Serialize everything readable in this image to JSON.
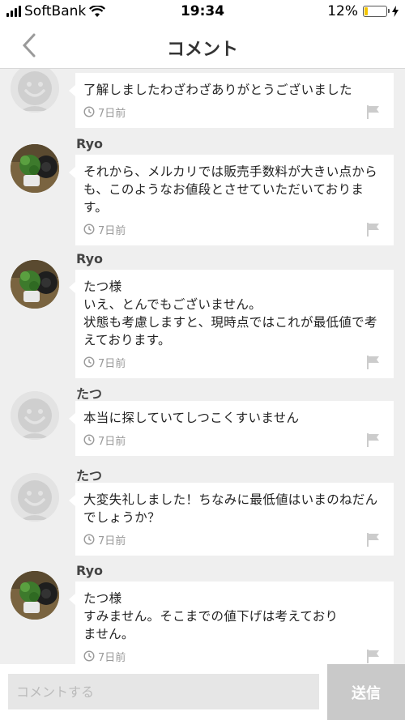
{
  "status_bar": {
    "carrier": "SoftBank",
    "time": "19:34",
    "battery": "12%"
  },
  "header": {
    "title": "コメント"
  },
  "comments": [
    {
      "user": "",
      "avatar": "default",
      "text": "了解しましたわざわざありがとうございました",
      "time": "7日前"
    },
    {
      "user": "Ryo",
      "avatar": "photo",
      "text": "それから、メルカリでは販売手数料が大きい点から\nも、このようなお値段とさせていただいておりま\nす。",
      "time": "7日前"
    },
    {
      "user": "Ryo",
      "avatar": "photo",
      "text": "たつ様\nいえ、とんでもございません。\n状態も考慮しますと、現時点ではこれが最低値で考\nえております。",
      "time": "7日前"
    },
    {
      "user": "たつ",
      "avatar": "default",
      "text": "本当に探していてしつこくすいません",
      "time": "7日前"
    },
    {
      "user": "たつ",
      "avatar": "default",
      "text": "大変失礼しました！ちなみに最低値はいまのねだん\nでしょうか？",
      "time": "7日前"
    },
    {
      "user": "Ryo",
      "avatar": "photo",
      "text": "たつ様\nすみません。そこまでの値下げは考えており\nません。",
      "time": "7日前"
    }
  ],
  "input": {
    "placeholder": "コメントする",
    "value": ""
  },
  "send_button": {
    "label": "送信"
  },
  "colors": {
    "accent": "#f3c400",
    "send_disabled": "#c9c9c9"
  }
}
